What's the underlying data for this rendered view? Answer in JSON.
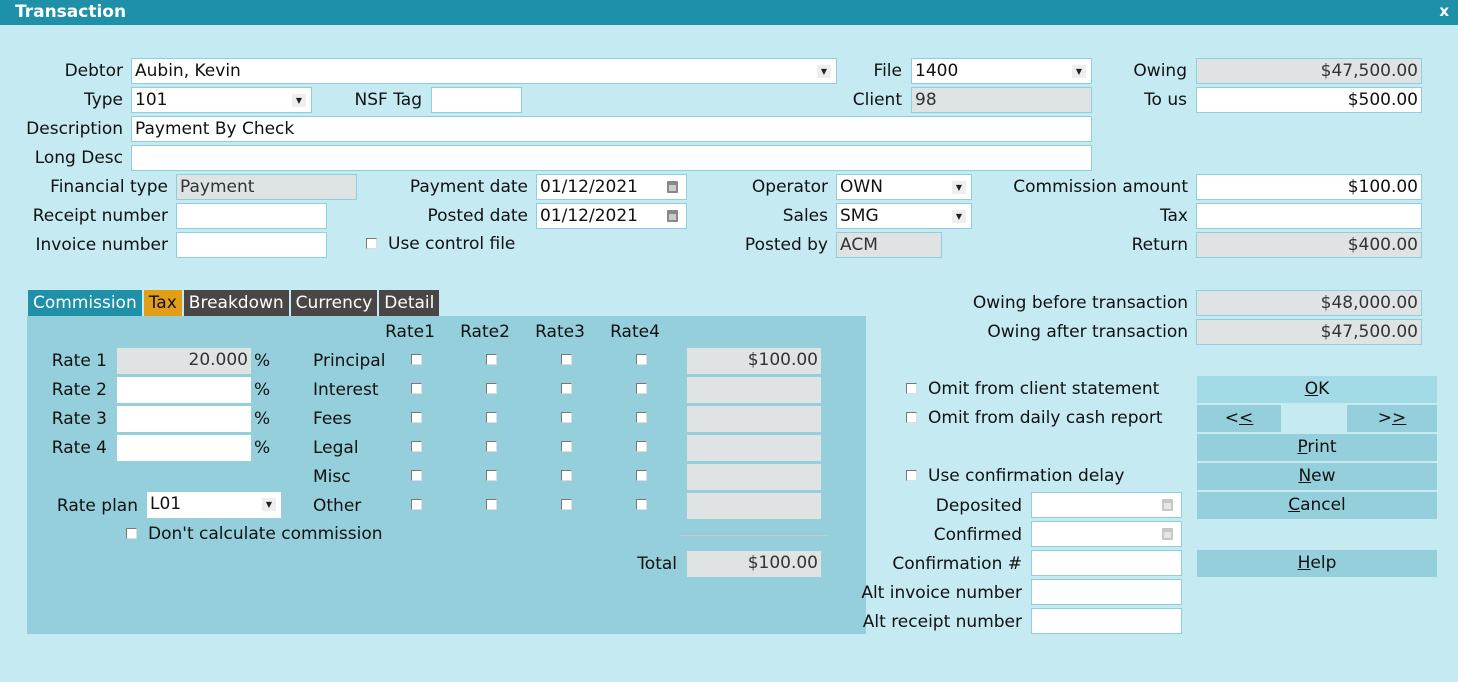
{
  "window": {
    "title": "Transaction",
    "close_label": "x"
  },
  "header": {
    "debtor": {
      "label": "Debtor",
      "value": "Aubin, Kevin"
    },
    "file": {
      "label": "File",
      "value": "1400"
    },
    "owing": {
      "label": "Owing",
      "value": "$47,500.00"
    },
    "type": {
      "label": "Type",
      "value": "101"
    },
    "nsf_tag": {
      "label": "NSF Tag",
      "value": ""
    },
    "client": {
      "label": "Client",
      "value": "98"
    },
    "to_us": {
      "label": "To us",
      "value": "$500.00"
    },
    "description": {
      "label": "Description",
      "value": "Payment By Check"
    },
    "long_desc": {
      "label": "Long Desc",
      "value": ""
    },
    "financial_type": {
      "label": "Financial type",
      "value": "Payment"
    },
    "payment_date": {
      "label": "Payment date",
      "value": "01/12/2021"
    },
    "operator": {
      "label": "Operator",
      "value": "OWN"
    },
    "commission_amount": {
      "label": "Commission amount",
      "value": "$100.00"
    },
    "receipt_number": {
      "label": "Receipt number",
      "value": ""
    },
    "posted_date": {
      "label": "Posted date",
      "value": "01/12/2021"
    },
    "sales": {
      "label": "Sales",
      "value": "SMG"
    },
    "tax": {
      "label": "Tax",
      "value": ""
    },
    "invoice_number": {
      "label": "Invoice number",
      "value": ""
    },
    "use_control_file": {
      "label": "Use control file",
      "checked": false
    },
    "posted_by": {
      "label": "Posted by",
      "value": "ACM"
    },
    "return": {
      "label": "Return",
      "value": "$400.00"
    }
  },
  "tabs": [
    {
      "label": "Commission",
      "active": true
    },
    {
      "label": "Tax",
      "active": false
    },
    {
      "label": "Breakdown",
      "active": false
    },
    {
      "label": "Currency",
      "active": false
    },
    {
      "label": "Detail",
      "active": false
    }
  ],
  "commission": {
    "rates": [
      {
        "label": "Rate 1",
        "value": "20.000",
        "unit": "%"
      },
      {
        "label": "Rate 2",
        "value": "",
        "unit": "%"
      },
      {
        "label": "Rate 3",
        "value": "",
        "unit": "%"
      },
      {
        "label": "Rate 4",
        "value": "",
        "unit": "%"
      }
    ],
    "rate_plan": {
      "label": "Rate plan",
      "value": "L01"
    },
    "dont_calculate": {
      "label": "Don't calculate commission",
      "checked": false
    },
    "columns": [
      "Rate1",
      "Rate2",
      "Rate3",
      "Rate4"
    ],
    "rows": [
      {
        "label": "Principal",
        "checks": [
          false,
          false,
          false,
          false
        ],
        "amount": "$100.00"
      },
      {
        "label": "Interest",
        "checks": [
          false,
          false,
          false,
          false
        ],
        "amount": ""
      },
      {
        "label": "Fees",
        "checks": [
          false,
          false,
          false,
          false
        ],
        "amount": ""
      },
      {
        "label": "Legal",
        "checks": [
          false,
          false,
          false,
          false
        ],
        "amount": ""
      },
      {
        "label": "Misc",
        "checks": [
          false,
          false,
          false,
          false
        ],
        "amount": ""
      },
      {
        "label": "Other",
        "checks": [
          false,
          false,
          false,
          false
        ],
        "amount": ""
      }
    ],
    "total": {
      "label": "Total",
      "value": "$100.00"
    }
  },
  "summary": {
    "owing_before": {
      "label": "Owing before transaction",
      "value": "$48,000.00"
    },
    "owing_after": {
      "label": "Owing after transaction",
      "value": "$47,500.00"
    }
  },
  "options": {
    "omit_client_statement": {
      "label": "Omit from client statement",
      "checked": false
    },
    "omit_daily_cash": {
      "label": "Omit from daily cash report",
      "checked": false
    },
    "use_confirmation_delay": {
      "label": "Use confirmation delay",
      "checked": false
    },
    "deposited": {
      "label": "Deposited",
      "value": ""
    },
    "confirmed": {
      "label": "Confirmed",
      "value": ""
    },
    "confirmation_no": {
      "label": "Confirmation #",
      "value": ""
    },
    "alt_invoice_number": {
      "label": "Alt invoice number",
      "value": ""
    },
    "alt_receipt_number": {
      "label": "Alt receipt number",
      "value": ""
    }
  },
  "buttons": {
    "ok": {
      "accel": "O",
      "rest": "K"
    },
    "prev": {
      "first": "<",
      "accel": "<"
    },
    "next": {
      "first": ">",
      "accel": ">"
    },
    "print": {
      "accel": "P",
      "rest": "rint"
    },
    "new": {
      "accel": "N",
      "rest": "ew"
    },
    "cancel": {
      "accel": "C",
      "rest": "ancel"
    },
    "help": {
      "accel": "H",
      "rest": "elp"
    }
  }
}
